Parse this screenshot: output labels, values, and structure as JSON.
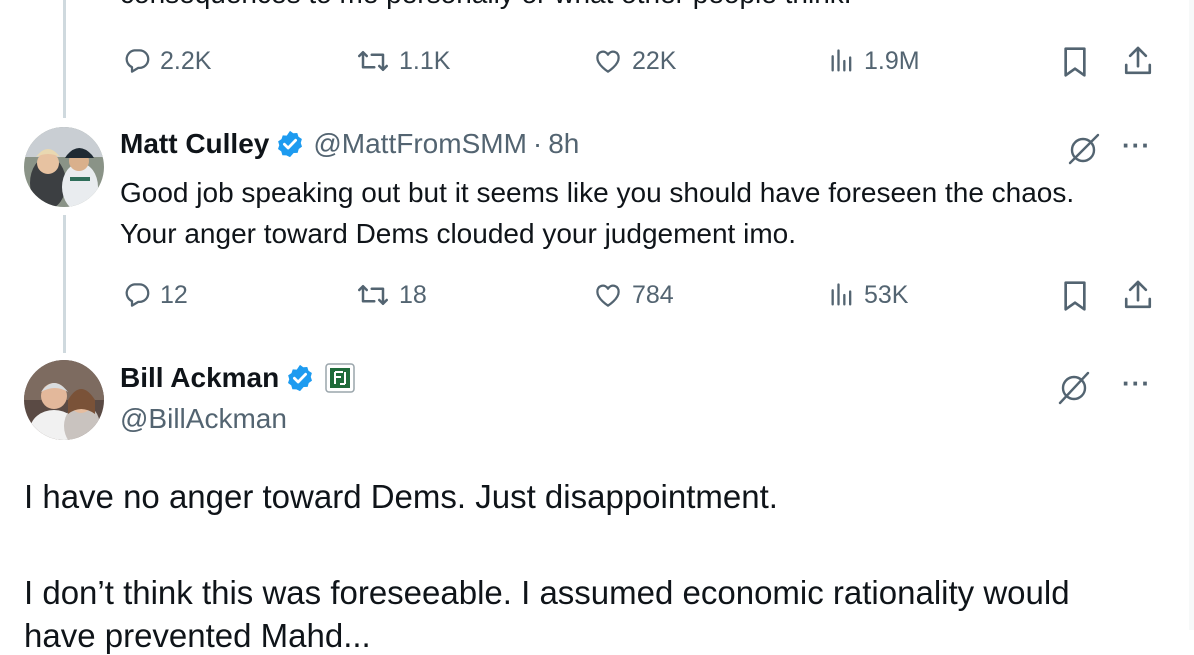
{
  "previous_tweet": {
    "clipped_text": "consequences to me personally or what other people think.",
    "actions": {
      "replies": "2.2K",
      "reposts": "1.1K",
      "likes": "22K",
      "views": "1.9M"
    }
  },
  "reply_tweet": {
    "display_name": "Matt Culley",
    "handle": "@MattFromSMM",
    "separator": "·",
    "time": "8h",
    "text": "Good job speaking out but it seems like you should have foreseen the chaos. Your anger toward Dems clouded your judgement imo.",
    "actions": {
      "replies": "12",
      "reposts": "18",
      "likes": "784",
      "views": "53K"
    }
  },
  "main_tweet": {
    "display_name": "Bill Ackman",
    "handle": "@BillAckman",
    "paragraph_1": "I have no anger toward Dems. Just disappointment.",
    "paragraph_2": "I don’t think this was foreseeable. I assumed economic rationality would",
    "paragraph_3_partial": "have prevented Mahd..."
  },
  "ui": {
    "more_label": "···",
    "colors": {
      "text": "#0f1419",
      "muted": "#536471",
      "verified": "#1d9bf0",
      "thread_line": "#cfd9de"
    }
  }
}
